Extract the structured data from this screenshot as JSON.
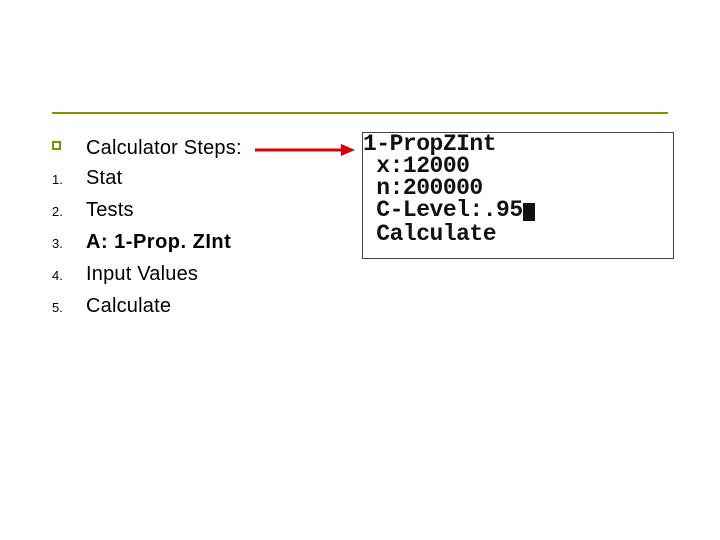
{
  "steps": {
    "title": "Calculator Steps:",
    "item1_num": "1.",
    "item1_txt": "Stat",
    "item2_num": "2.",
    "item2_txt": "Tests",
    "item3_num": "3.",
    "item3_txt": "A: 1-Prop. ZInt",
    "item4_num": "4.",
    "item4_txt": "Input Values",
    "item5_num": "5.",
    "item5_txt": "Calculate"
  },
  "calc": {
    "line1": "1-PropZInt",
    "line2_label": " x:",
    "line2_val": "12000",
    "line3_label": " n:",
    "line3_val": "200000",
    "line4_label": " C-Level:",
    "line4_val": ".95",
    "line5": " Calculate"
  }
}
